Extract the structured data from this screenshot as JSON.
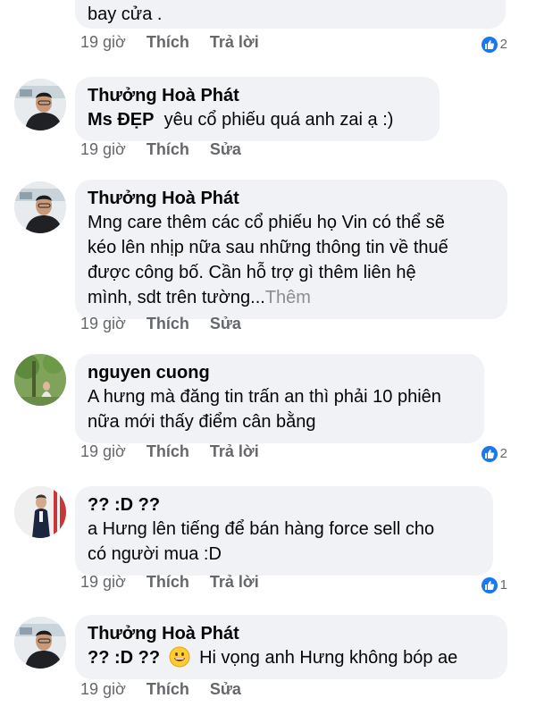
{
  "comments": [
    {
      "text": "bay cửa .",
      "time": "19 giờ",
      "action1": "Thích",
      "action2": "Trả lời",
      "reactions": "2"
    },
    {
      "author": "Thưởng Hoà Phát",
      "mention": "Ms ĐẸP",
      "text": "yêu cổ phiếu quá anh zai ạ :)",
      "time": "19 giờ",
      "action1": "Thích",
      "action2": "Sửa"
    },
    {
      "author": "Thưởng Hoà Phát",
      "text_lines": [
        "Mng care thêm các cổ phiếu họ Vin có thể sẽ",
        "kéo lên nhịp nữa sau những thông tin về thuế",
        "được công bố. Cần hỗ trợ gì thêm liên hệ",
        "mình, sdt trên tường..."
      ],
      "more_label": "Thêm",
      "time": "19 giờ",
      "action1": "Thích",
      "action2": "Sửa"
    },
    {
      "author": "nguyen cuong",
      "text_lines": [
        "A hưng mà đăng tin trấn an thì phải 10 phiên",
        "nữa mới thấy điểm cân bằng"
      ],
      "time": "19 giờ",
      "action1": "Thích",
      "action2": "Trả lời",
      "reactions": "2"
    },
    {
      "author": "?? :D ??",
      "text_lines": [
        "a Hưng lên tiếng để bán hàng force sell cho",
        "có người mua :D"
      ],
      "time": "19 giờ",
      "action1": "Thích",
      "action2": "Trả lời",
      "reactions": "1"
    },
    {
      "author": "Thưởng Hoà Phát",
      "mention": "?? :D ??",
      "text": "Hi vọng anh Hưng không bóp ae",
      "time": "19 giờ",
      "action1": "Thích",
      "action2": "Sửa"
    }
  ]
}
